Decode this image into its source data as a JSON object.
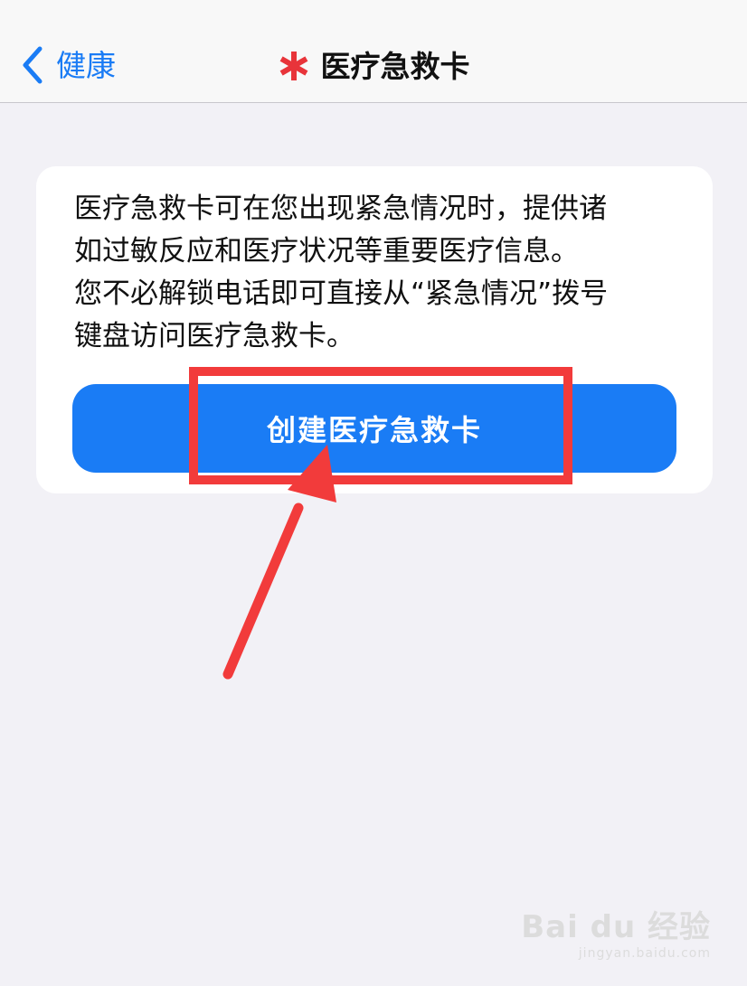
{
  "nav": {
    "back_label": "健康",
    "title": "医疗急救卡"
  },
  "card": {
    "description_lines": [
      "医疗急救卡可在您出现紧急情况时，提供诸",
      "如过敏反应和医疗状况等重要医疗信息。",
      "您不必解锁电话即可直接从“紧急情况”拨号",
      "键盘访问医疗急救卡。"
    ],
    "create_button_label": "创建医疗急救卡"
  },
  "watermark": {
    "logo": "Bai du 经验",
    "url": "jingyan.baidu.com"
  },
  "colors": {
    "accent_blue": "#1a7cf5",
    "medical_star_red": "#e8343a",
    "annotation_red": "#f23b3b",
    "background": "#f2f1f6",
    "card_background": "#ffffff"
  },
  "icons": {
    "back": "chevron-left-icon",
    "title": "medical-star-icon",
    "annotation": "arrow-pointer-icon"
  }
}
